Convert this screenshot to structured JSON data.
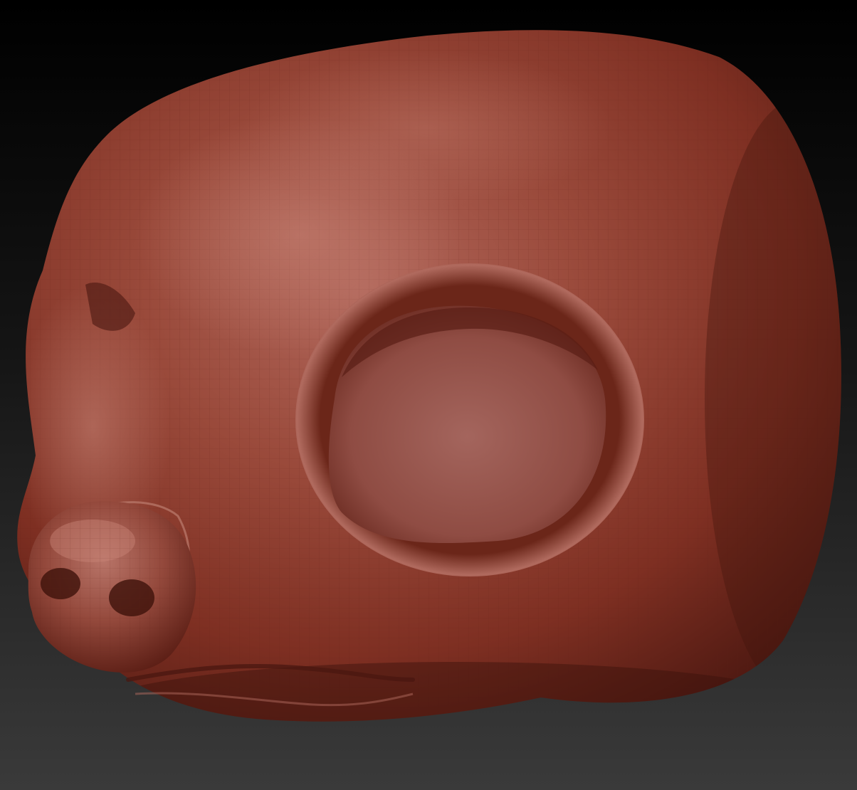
{
  "viewport": {
    "background_top": "#000000",
    "background_bottom": "#3a3a3a"
  },
  "model": {
    "material": "red-wax-clay",
    "base_color": "#8a3628",
    "highlight_color": "#c27a6c",
    "shadow_color": "#4a1710",
    "wire_color": "#5e1f16",
    "parts": [
      "head-mesh",
      "eye-socket",
      "snout",
      "nose",
      "nostril-left",
      "nostril-right",
      "mouth-line"
    ]
  }
}
